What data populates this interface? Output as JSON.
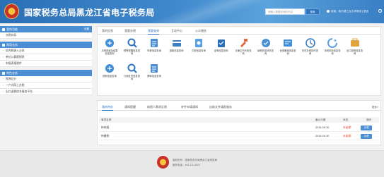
{
  "header": {
    "title": "国家税务总局黑龙江省电子税务局",
    "search_placeholder": "请输入需要查询的内容",
    "search_button": "搜索",
    "user_text": "欢迎，哈尔滨工业大学测试  | 退出"
  },
  "sidebar": {
    "groups": [
      {
        "title": "我的功能",
        "more": "设置",
        "items": [
          "办税向导"
        ]
      },
      {
        "title": "常用业务",
        "more": "",
        "items": [
          "综合税源入企表",
          "单位公募报税表",
          "申报表报税件"
        ]
      },
      {
        "title": "特色业务",
        "more": "",
        "items": [
          "税源总分",
          "一户式网上办税",
          "出口退税综合服务平台"
        ]
      }
    ]
  },
  "main": {
    "tabs": [
      "我的信息",
      "我要办税",
      "我要查询",
      "互动中心",
      "公众服务"
    ],
    "active_tab": "我要查询",
    "icons_row1": [
      {
        "label": "办税进度及结果信息查询",
        "color": "#3f8fd9"
      },
      {
        "label": "预警提醒信息查询",
        "color": "#2f74c0"
      },
      {
        "label": "申报信息查询",
        "color": "#4a8fd4"
      },
      {
        "label": "缴款信息查询",
        "color": "#3a7fc4"
      },
      {
        "label": "欠税信息查询",
        "color": "#5aa0e0"
      },
      {
        "label": "证明信息查询",
        "color": "#2b6fb6"
      },
      {
        "label": "法律文书代收查询",
        "color": "#e26a3d"
      },
      {
        "label": "纳税信用状态查询",
        "color": "#4a8fd4"
      },
      {
        "label": "优惠备案信息查询",
        "color": "#3f8fd9"
      },
      {
        "label": "历史办税操作查询",
        "color": "#2f74c0"
      },
      {
        "label": "涉税风险信息查询",
        "color": "#5aa0e0"
      },
      {
        "label": "出口退税信息查询",
        "color": "#e2a43d"
      }
    ],
    "icons_row2": [
      {
        "label": "税种信息查询",
        "color": "#3f8fd9"
      },
      {
        "label": "行政处罚信息查询",
        "color": "#2f74c0"
      },
      {
        "label": "票种信息查询",
        "color": "#4a8fd4"
      }
    ]
  },
  "panel": {
    "tabs": [
      "我的待办",
      "通知提醒",
      "纳税人需求反馈",
      "补件申请通知",
      "自助文件填报服务"
    ],
    "more": "更多»",
    "columns": [
      "事项名称",
      "截止日期",
      "状态",
      "操作"
    ],
    "rows": [
      {
        "name": "待申报",
        "date": "2016-09-30",
        "status": "未逾期",
        "op": "办理"
      },
      {
        "name": "待缴税",
        "date": "2016-09-30",
        "status": "未逾期",
        "op": "办理"
      }
    ]
  },
  "footer": {
    "line1": "版权所有：国家税务总局黑龙江省税务局",
    "line2": "服务电话：400-111-0022"
  }
}
